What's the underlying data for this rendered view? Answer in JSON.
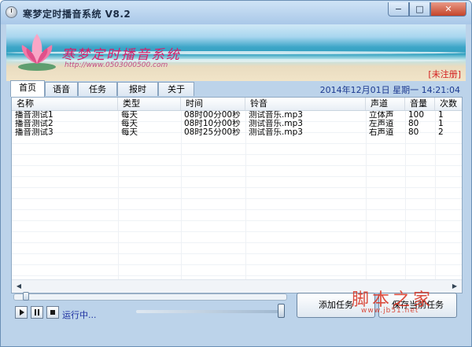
{
  "window": {
    "title": "寒梦定时播音系统 V8.2",
    "controls": {
      "minimize": "−",
      "maximize": "□",
      "close": "✕"
    }
  },
  "banner": {
    "brand": "寒梦定时播音系统",
    "url": "http://www.0503000500.com",
    "register": "[未注册]"
  },
  "tabs": [
    "首页",
    "语音",
    "任务",
    "报时",
    "关于"
  ],
  "datetime": "2014年12月01日 星期一 14:21:04",
  "table": {
    "columns": [
      "名称",
      "类型",
      "时间",
      "铃音",
      "声道",
      "音量",
      "次数"
    ],
    "rows": [
      [
        "播音测试1",
        "每天",
        "08时00分00秒",
        "测试音乐.mp3",
        "立体声",
        "100",
        "1"
      ],
      [
        "播音测试2",
        "每天",
        "08时10分00秒",
        "测试音乐.mp3",
        "左声道",
        "80",
        "1"
      ],
      [
        "播音测试3",
        "每天",
        "08时25分00秒",
        "测试音乐.mp3",
        "右声道",
        "80",
        "2"
      ]
    ]
  },
  "player": {
    "status": "运行中...",
    "progress": 0.02,
    "volume": 1.0
  },
  "buttons": {
    "add_task": "添加任务",
    "save_task": "保存当前任务"
  },
  "watermark": {
    "main": "脚本之家",
    "url": "www.jb51.net"
  }
}
